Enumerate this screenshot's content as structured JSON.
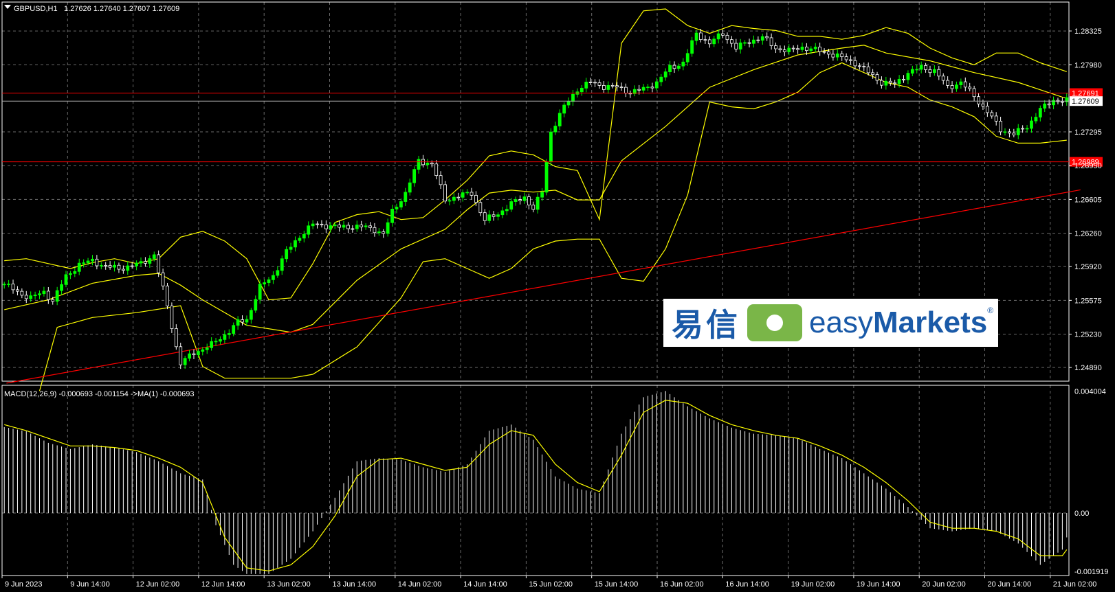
{
  "header": {
    "symbol_tf": "GBPUSD,H1",
    "quotes": "1.27626 1.27640 1.27607 1.27609"
  },
  "macd_header": "MACD(12,26,9) -0.000693 -0.001154  ->MA(1) -0.000693",
  "logo": {
    "chinese": "易信",
    "english_light": "easy",
    "english_bold": "Markets",
    "reg": "®"
  },
  "colors": {
    "bg": "#000000",
    "grid": "#6b6b6b",
    "bull": "#00ff00",
    "bear": "#ffffff",
    "bands": "#ffff00",
    "hline": "#ff0000",
    "trend": "#ff0000",
    "macd_hist": "#ffffff",
    "signal": "#ffff00"
  },
  "chart_data": [
    {
      "type": "candlestick",
      "symbol": "GBPUSD",
      "timeframe": "H1",
      "ylim": [
        1.2475,
        1.2862
      ],
      "yticks": [
        1.2489,
        1.2523,
        1.25575,
        1.2592,
        1.2626,
        1.26605,
        1.2695,
        1.27295,
        1.2798,
        1.28325
      ],
      "ytick_labels": [
        "1.24890",
        "1.25230",
        "1.25575",
        "1.25920",
        "1.26260",
        "1.26605",
        "1.26950",
        "1.27295",
        "1.27980",
        "1.28325"
      ],
      "xtick_labels": [
        "9 Jun 2023",
        "9 Jun 14:00",
        "12 Jun 02:00",
        "12 Jun 14:00",
        "13 Jun 02:00",
        "13 Jun 14:00",
        "14 Jun 02:00",
        "14 Jun 14:00",
        "15 Jun 02:00",
        "15 Jun 14:00",
        "16 Jun 02:00",
        "16 Jun 14:00",
        "19 Jun 02:00",
        "19 Jun 14:00",
        "20 Jun 02:00",
        "20 Jun 14:00",
        "21 Jun 02:00"
      ],
      "current_price_label": "1.27609",
      "current_price": 1.27609,
      "horizontal_lines": [
        {
          "label": "1.27691",
          "value": 1.27691
        },
        {
          "label": "1.26989",
          "value": 1.26989
        }
      ],
      "trendline": {
        "start": [
          1.2473,
          0.5
        ],
        "end": [
          1.26647,
          133
        ]
      },
      "close_path": [
        [
          0,
          1.2574
        ],
        [
          3,
          1.2566
        ],
        [
          6,
          1.256
        ],
        [
          9,
          1.2566
        ],
        [
          11,
          1.2557
        ],
        [
          14,
          1.2582
        ],
        [
          17,
          1.2594
        ],
        [
          20,
          1.2598
        ],
        [
          23,
          1.2592
        ],
        [
          26,
          1.259
        ],
        [
          28,
          1.2592
        ],
        [
          31,
          1.2595
        ],
        [
          34,
          1.2604
        ],
        [
          35,
          1.2586
        ],
        [
          37,
          1.2552
        ],
        [
          39,
          1.251
        ],
        [
          40,
          1.2493
        ],
        [
          43,
          1.2504
        ],
        [
          47,
          1.2512
        ],
        [
          51,
          1.2526
        ],
        [
          53,
          1.2535
        ],
        [
          55,
          1.2538
        ],
        [
          58,
          1.2571
        ],
        [
          61,
          1.2583
        ],
        [
          64,
          1.2607
        ],
        [
          67,
          1.2623
        ],
        [
          70,
          1.2635
        ],
        [
          73,
          1.2634
        ],
        [
          76,
          1.2632
        ],
        [
          79,
          1.2633
        ],
        [
          82,
          1.2632
        ],
        [
          84,
          1.263
        ],
        [
          86,
          1.2625
        ],
        [
          88,
          1.2648
        ],
        [
          91,
          1.2667
        ],
        [
          94,
          1.27
        ],
        [
          97,
          1.2697
        ],
        [
          100,
          1.266
        ],
        [
          103,
          1.2664
        ],
        [
          106,
          1.2667
        ],
        [
          109,
          1.2639
        ],
        [
          112,
          1.2646
        ],
        [
          115,
          1.2656
        ],
        [
          118,
          1.2663
        ],
        [
          120,
          1.2651
        ],
        [
          122,
          1.2668
        ],
        [
          124,
          1.273
        ],
        [
          127,
          1.2755
        ],
        [
          130,
          1.2773
        ],
        [
          133,
          1.278
        ],
        [
          136,
          1.2776
        ],
        [
          139,
          1.2775
        ],
        [
          142,
          1.277
        ],
        [
          145,
          1.2773
        ],
        [
          148,
          1.278
        ],
        [
          151,
          1.2795
        ],
        [
          154,
          1.28
        ],
        [
          157,
          1.283
        ],
        [
          160,
          1.282
        ],
        [
          163,
          1.283
        ],
        [
          166,
          1.2815
        ],
        [
          169,
          1.2822
        ],
        [
          172,
          1.2826
        ],
        [
          175,
          1.2815
        ],
        [
          178,
          1.2812
        ],
        [
          181,
          1.2816
        ],
        [
          184,
          1.2813
        ],
        [
          187,
          1.281
        ],
        [
          190,
          1.2805
        ],
        [
          193,
          1.28
        ],
        [
          196,
          1.279
        ],
        [
          199,
          1.278
        ],
        [
          202,
          1.2778
        ],
        [
          205,
          1.279
        ],
        [
          208,
          1.2795
        ],
        [
          211,
          1.2792
        ],
        [
          214,
          1.2775
        ],
        [
          217,
          1.278
        ],
        [
          220,
          1.2766
        ],
        [
          223,
          1.275
        ],
        [
          226,
          1.2732
        ],
        [
          229,
          1.2727
        ],
        [
          232,
          1.2735
        ],
        [
          235,
          1.2752
        ],
        [
          238,
          1.2762
        ],
        [
          241,
          1.2761
        ]
      ],
      "bollinger_upper": [
        [
          0,
          1.2598
        ],
        [
          5,
          1.26
        ],
        [
          10,
          1.2595
        ],
        [
          15,
          1.259
        ],
        [
          20,
          1.2596
        ],
        [
          25,
          1.26
        ],
        [
          30,
          1.2595
        ],
        [
          35,
          1.26
        ],
        [
          40,
          1.2622
        ],
        [
          45,
          1.2628
        ],
        [
          50,
          1.2618
        ],
        [
          55,
          1.26
        ],
        [
          60,
          1.2558
        ],
        [
          65,
          1.256
        ],
        [
          70,
          1.2595
        ],
        [
          75,
          1.2637
        ],
        [
          80,
          1.2645
        ],
        [
          85,
          1.2648
        ],
        [
          90,
          1.264
        ],
        [
          95,
          1.2642
        ],
        [
          100,
          1.266
        ],
        [
          105,
          1.268
        ],
        [
          110,
          1.2705
        ],
        [
          115,
          1.271
        ],
        [
          120,
          1.2706
        ],
        [
          125,
          1.2694
        ],
        [
          130,
          1.269
        ],
        [
          135,
          1.264
        ],
        [
          140,
          1.282
        ],
        [
          145,
          1.2853
        ],
        [
          150,
          1.2855
        ],
        [
          155,
          1.2838
        ],
        [
          160,
          1.283
        ],
        [
          165,
          1.2838
        ],
        [
          170,
          1.2835
        ],
        [
          175,
          1.2833
        ],
        [
          180,
          1.2827
        ],
        [
          185,
          1.2827
        ],
        [
          190,
          1.2824
        ],
        [
          195,
          1.2828
        ],
        [
          200,
          1.2836
        ],
        [
          205,
          1.283
        ],
        [
          210,
          1.2815
        ],
        [
          215,
          1.2805
        ],
        [
          220,
          1.2798
        ],
        [
          225,
          1.281
        ],
        [
          230,
          1.281
        ],
        [
          235,
          1.28
        ],
        [
          241,
          1.2791
        ]
      ],
      "bollinger_middle": [
        [
          0,
          1.2548
        ],
        [
          10,
          1.2558
        ],
        [
          20,
          1.2575
        ],
        [
          30,
          1.2583
        ],
        [
          35,
          1.2585
        ],
        [
          40,
          1.2573
        ],
        [
          45,
          1.2558
        ],
        [
          55,
          1.2532
        ],
        [
          65,
          1.2525
        ],
        [
          70,
          1.2533
        ],
        [
          80,
          1.2578
        ],
        [
          90,
          1.261
        ],
        [
          100,
          1.263
        ],
        [
          105,
          1.265
        ],
        [
          110,
          1.2667
        ],
        [
          115,
          1.267
        ],
        [
          120,
          1.2668
        ],
        [
          125,
          1.267
        ],
        [
          130,
          1.266
        ],
        [
          135,
          1.266
        ],
        [
          140,
          1.27
        ],
        [
          150,
          1.2735
        ],
        [
          160,
          1.2775
        ],
        [
          170,
          1.2793
        ],
        [
          180,
          1.2808
        ],
        [
          190,
          1.2815
        ],
        [
          195,
          1.2818
        ],
        [
          200,
          1.281
        ],
        [
          210,
          1.2802
        ],
        [
          220,
          1.279
        ],
        [
          230,
          1.278
        ],
        [
          240,
          1.2765
        ],
        [
          241,
          1.2764
        ]
      ],
      "bollinger_lower": [
        [
          8,
          1.2465
        ],
        [
          12,
          1.253
        ],
        [
          20,
          1.254
        ],
        [
          30,
          1.2545
        ],
        [
          40,
          1.2552
        ],
        [
          45,
          1.249
        ],
        [
          50,
          1.2478
        ],
        [
          65,
          1.2478
        ],
        [
          70,
          1.2482
        ],
        [
          80,
          1.251
        ],
        [
          90,
          1.256
        ],
        [
          95,
          1.2597
        ],
        [
          100,
          1.26
        ],
        [
          105,
          1.259
        ],
        [
          110,
          1.258
        ],
        [
          115,
          1.259
        ],
        [
          120,
          1.261
        ],
        [
          125,
          1.2618
        ],
        [
          130,
          1.262
        ],
        [
          135,
          1.262
        ],
        [
          140,
          1.258
        ],
        [
          145,
          1.2577
        ],
        [
          150,
          1.261
        ],
        [
          155,
          1.2665
        ],
        [
          160,
          1.276
        ],
        [
          165,
          1.2755
        ],
        [
          170,
          1.2753
        ],
        [
          175,
          1.276
        ],
        [
          180,
          1.277
        ],
        [
          185,
          1.279
        ],
        [
          190,
          1.28
        ],
        [
          195,
          1.279
        ],
        [
          200,
          1.278
        ],
        [
          205,
          1.2775
        ],
        [
          210,
          1.2762
        ],
        [
          215,
          1.2755
        ],
        [
          220,
          1.2745
        ],
        [
          225,
          1.2725
        ],
        [
          230,
          1.2718
        ],
        [
          235,
          1.2718
        ],
        [
          241,
          1.2721
        ]
      ]
    },
    {
      "type": "bar",
      "name": "MACD(12,26,9)",
      "ylim": [
        -0.00205,
        0.00419
      ],
      "yticks": [
        0.004004,
        0.0,
        -0.001919
      ],
      "ytick_labels": [
        "0.004004",
        "0.00",
        "-0.001919"
      ],
      "macd_path": [
        [
          0,
          0.00282
        ],
        [
          5,
          0.00268
        ],
        [
          10,
          0.0023
        ],
        [
          15,
          0.0021
        ],
        [
          20,
          0.00225
        ],
        [
          25,
          0.00215
        ],
        [
          30,
          0.002
        ],
        [
          35,
          0.0017
        ],
        [
          40,
          0.0013
        ],
        [
          45,
          0.0011
        ],
        [
          48,
          -0.0004
        ],
        [
          52,
          -0.0017
        ],
        [
          55,
          -0.002
        ],
        [
          60,
          -0.002
        ],
        [
          65,
          -0.0015
        ],
        [
          70,
          -0.0006
        ],
        [
          75,
          0.0005
        ],
        [
          80,
          0.0017
        ],
        [
          85,
          0.0018
        ],
        [
          90,
          0.00175
        ],
        [
          95,
          0.0015
        ],
        [
          100,
          0.00135
        ],
        [
          105,
          0.0016
        ],
        [
          110,
          0.0027
        ],
        [
          115,
          0.0029
        ],
        [
          120,
          0.0024
        ],
        [
          125,
          0.0012
        ],
        [
          130,
          0.0008
        ],
        [
          135,
          0.00065
        ],
        [
          140,
          0.0026
        ],
        [
          145,
          0.0038
        ],
        [
          150,
          0.004
        ],
        [
          155,
          0.0035
        ],
        [
          160,
          0.0031
        ],
        [
          165,
          0.0028
        ],
        [
          170,
          0.0026
        ],
        [
          175,
          0.00255
        ],
        [
          180,
          0.00245
        ],
        [
          185,
          0.0021
        ],
        [
          190,
          0.0018
        ],
        [
          195,
          0.0013
        ],
        [
          200,
          0.0008
        ],
        [
          205,
          0.0002
        ],
        [
          210,
          -0.0005
        ],
        [
          215,
          -0.0006
        ],
        [
          220,
          -0.0005
        ],
        [
          225,
          -0.0006
        ],
        [
          230,
          -0.001
        ],
        [
          235,
          -0.0017
        ],
        [
          240,
          -0.0012
        ],
        [
          241,
          -0.0008
        ]
      ],
      "signal_path": [
        [
          0,
          0.0029
        ],
        [
          5,
          0.0027
        ],
        [
          10,
          0.00245
        ],
        [
          15,
          0.0022
        ],
        [
          20,
          0.0022
        ],
        [
          25,
          0.00215
        ],
        [
          30,
          0.00205
        ],
        [
          35,
          0.0018
        ],
        [
          40,
          0.0015
        ],
        [
          45,
          0.001
        ],
        [
          50,
          -0.0008
        ],
        [
          55,
          -0.0018
        ],
        [
          60,
          -0.0019
        ],
        [
          65,
          -0.0017
        ],
        [
          70,
          -0.0011
        ],
        [
          75,
          -0.0001
        ],
        [
          80,
          0.0012
        ],
        [
          85,
          0.00175
        ],
        [
          90,
          0.0018
        ],
        [
          95,
          0.0016
        ],
        [
          100,
          0.0014
        ],
        [
          105,
          0.0015
        ],
        [
          110,
          0.00225
        ],
        [
          115,
          0.0027
        ],
        [
          120,
          0.00255
        ],
        [
          125,
          0.0016
        ],
        [
          130,
          0.001
        ],
        [
          135,
          0.0007
        ],
        [
          140,
          0.0019
        ],
        [
          145,
          0.0033
        ],
        [
          150,
          0.0037
        ],
        [
          155,
          0.0036
        ],
        [
          160,
          0.0032
        ],
        [
          165,
          0.0029
        ],
        [
          170,
          0.0027
        ],
        [
          175,
          0.00255
        ],
        [
          180,
          0.00245
        ],
        [
          185,
          0.0022
        ],
        [
          190,
          0.0019
        ],
        [
          195,
          0.0015
        ],
        [
          200,
          0.001
        ],
        [
          205,
          0.0004
        ],
        [
          210,
          -0.0003
        ],
        [
          215,
          -0.0005
        ],
        [
          220,
          -0.0005
        ],
        [
          225,
          -0.0006
        ],
        [
          230,
          -0.00085
        ],
        [
          235,
          -0.0014
        ],
        [
          240,
          -0.0014
        ],
        [
          241,
          -0.0012
        ]
      ]
    }
  ]
}
